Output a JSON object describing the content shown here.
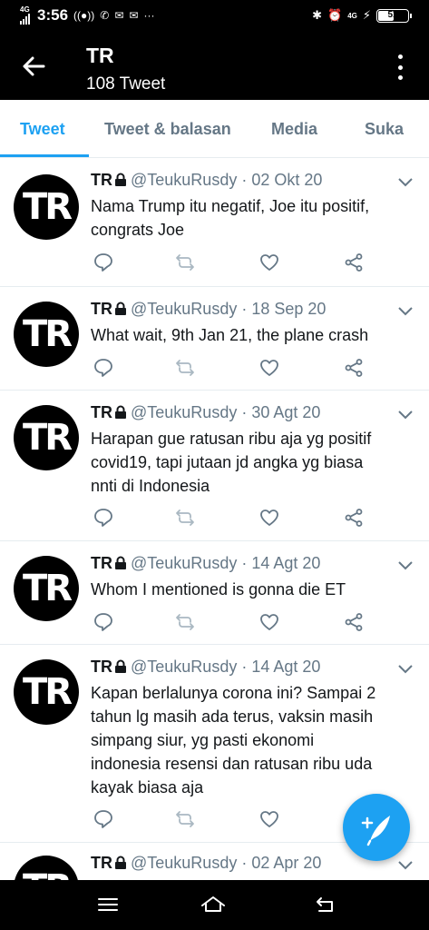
{
  "status_bar": {
    "network": "4G",
    "time": "3:56",
    "network_right": "4G",
    "battery": "51"
  },
  "header": {
    "title": "TR",
    "subtitle": "108 Tweet"
  },
  "tabs": [
    {
      "label": "Tweet",
      "active": true
    },
    {
      "label": "Tweet & balasan",
      "active": false
    },
    {
      "label": "Media",
      "active": false
    },
    {
      "label": "Suka",
      "active": false
    }
  ],
  "avatar_text": "TR",
  "tweets": [
    {
      "name": "TR",
      "handle": "@TeukuRusdy",
      "separator": "·",
      "date": "02 Okt 20",
      "lines": [
        "Nama Trump itu negatif, Joe itu positif,",
        "congrats Joe"
      ]
    },
    {
      "name": "TR",
      "handle": "@TeukuRusdy",
      "separator": "·",
      "date": "18 Sep 20",
      "lines": [
        "What wait, 9th Jan 21, the plane crash"
      ]
    },
    {
      "name": "TR",
      "handle": "@TeukuRusdy",
      "separator": "·",
      "date": "30 Agt 20",
      "lines": [
        "Harapan gue ratusan ribu aja yg positif",
        "covid19, tapi jutaan jd angka yg biasa",
        "nnti di Indonesia"
      ]
    },
    {
      "name": "TR",
      "handle": "@TeukuRusdy",
      "separator": "·",
      "date": "14 Agt 20",
      "lines": [
        "Whom I mentioned is gonna die ET"
      ]
    },
    {
      "name": "TR",
      "handle": "@TeukuRusdy",
      "separator": "·",
      "date": "14 Agt 20",
      "lines": [
        "Kapan berlalunya corona ini? Sampai 2",
        "tahun lg masih ada terus, vaksin masih",
        "simpang siur, yg pasti ekonomi",
        "indonesia resensi dan ratusan ribu uda",
        "kayak biasa aja"
      ]
    },
    {
      "name": "TR",
      "handle": "@TeukuRusdy",
      "separator": "·",
      "date": "02 Apr 20",
      "lines": []
    }
  ],
  "icons": {
    "back": "arrow-left-icon",
    "menu": "more-vertical-icon",
    "reply": "reply-icon",
    "retweet": "retweet-icon",
    "like": "heart-icon",
    "share": "share-icon",
    "lock": "lock-icon",
    "compose": "compose-tweet-icon"
  },
  "colors": {
    "accent": "#1da1f2",
    "secondary_text": "#657786",
    "retweet_disabled": "#aab8c2"
  }
}
